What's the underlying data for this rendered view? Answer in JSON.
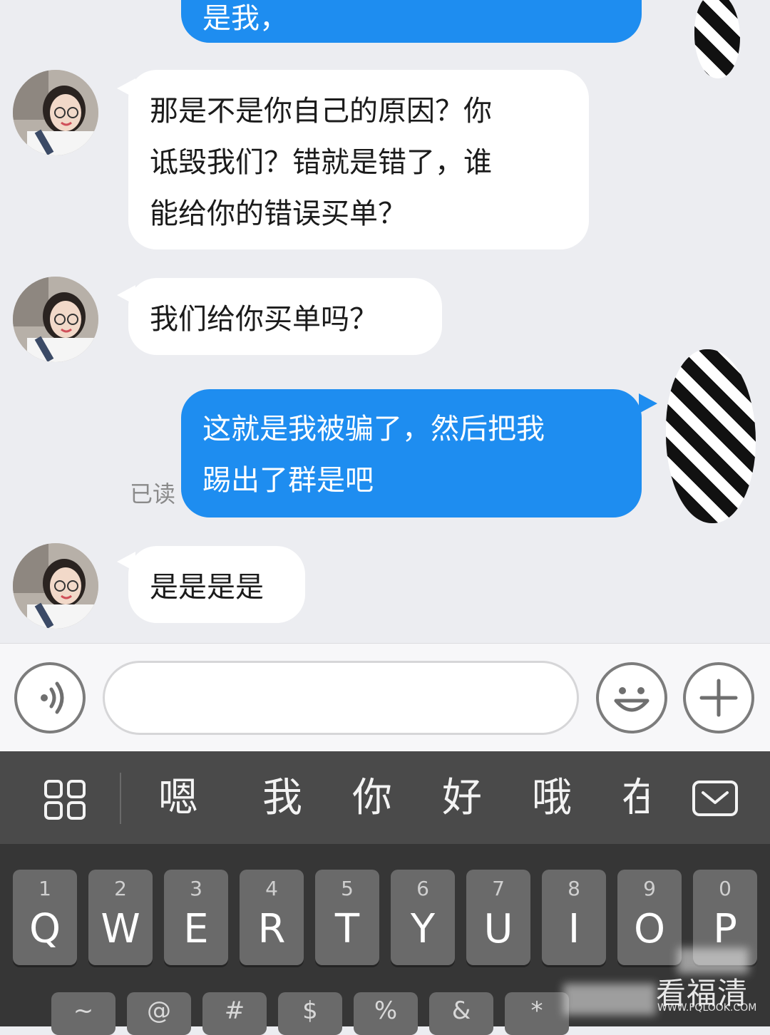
{
  "messages": [
    {
      "from": "me",
      "text": "是我，"
    },
    {
      "from": "them",
      "text": "那是不是你自己的原因？你\n诋毁我们？错就是错了，谁\n能给你的错误买单？"
    },
    {
      "from": "them",
      "text": "我们给你买单吗？"
    },
    {
      "from": "me",
      "text": "这就是我被骗了，然后把我\n踢出了群是吧",
      "status": "已读"
    },
    {
      "from": "them",
      "text": "是是是是"
    }
  ],
  "input": {
    "voice_icon": "voice-icon",
    "emoji_icon": "emoji-icon",
    "plus_icon": "plus-icon",
    "placeholder": ""
  },
  "candidates": [
    "嗯",
    "我",
    "你",
    "好",
    "哦",
    "在"
  ],
  "keyboard": {
    "row1": [
      {
        "num": "1",
        "key": "Q"
      },
      {
        "num": "2",
        "key": "W"
      },
      {
        "num": "3",
        "key": "E"
      },
      {
        "num": "4",
        "key": "R"
      },
      {
        "num": "5",
        "key": "T"
      },
      {
        "num": "6",
        "key": "Y"
      },
      {
        "num": "7",
        "key": "U"
      },
      {
        "num": "8",
        "key": "I"
      },
      {
        "num": "9",
        "key": "O"
      },
      {
        "num": "0",
        "key": "P"
      }
    ],
    "row2_symbols": [
      "~",
      "@",
      "#",
      "$",
      "%",
      "&",
      "*"
    ]
  },
  "watermark": {
    "brand": "看福清",
    "url": "WWW.FQLOOK.COM"
  },
  "colors": {
    "outgoing_bubble": "#1e8df0",
    "incoming_bubble": "#ffffff",
    "chat_bg": "#ecedf1",
    "keyboard_bg": "#363636"
  }
}
